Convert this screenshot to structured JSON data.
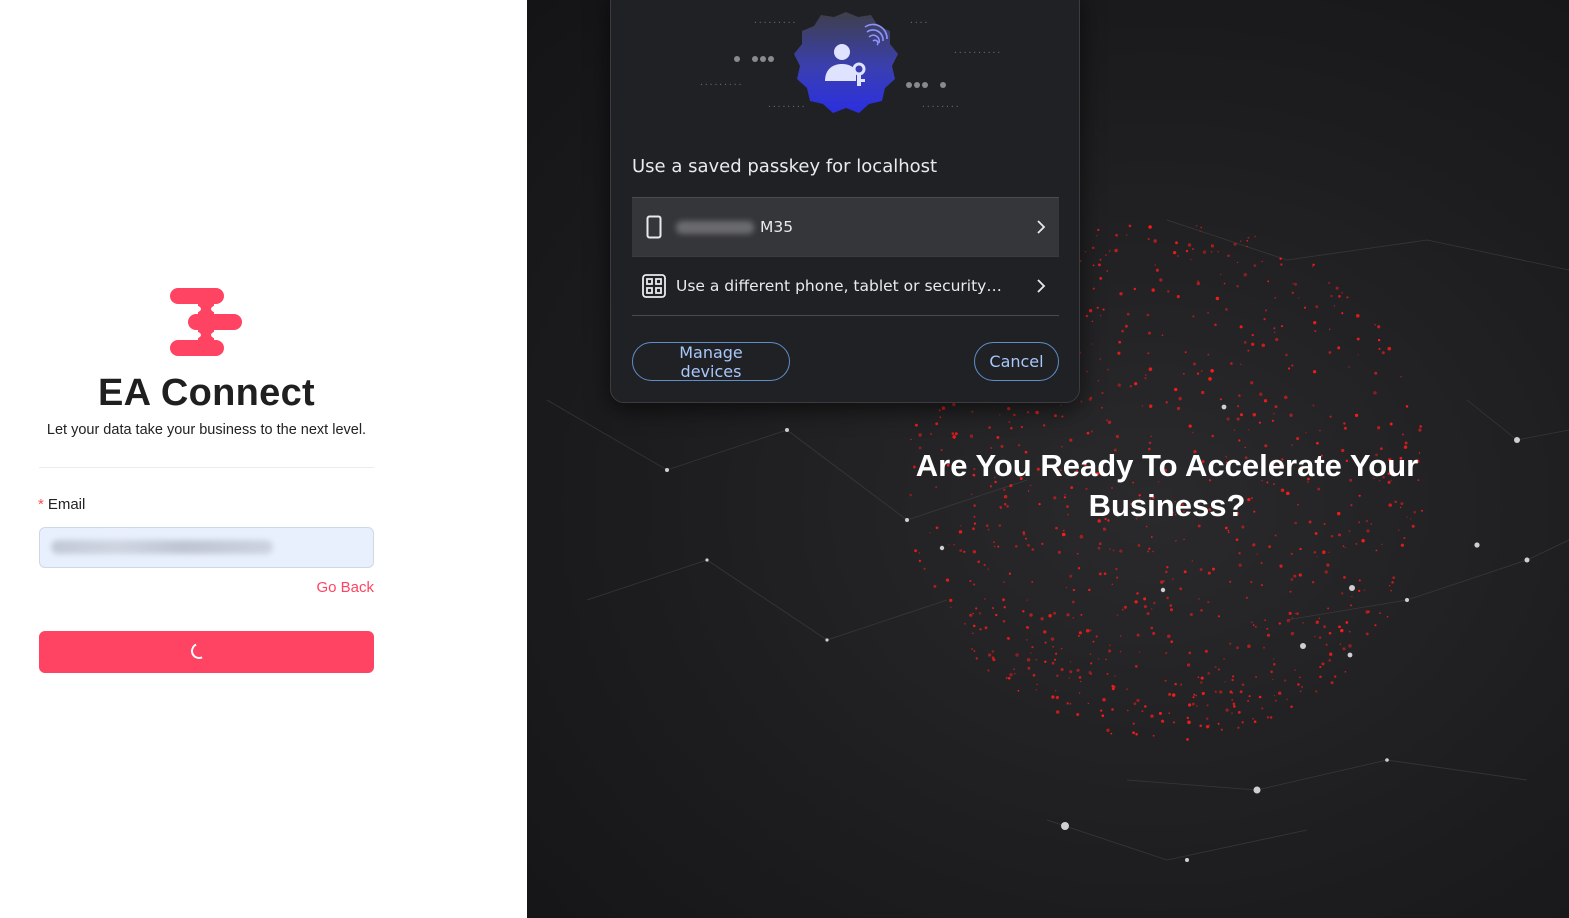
{
  "login": {
    "brand": "EA Connect",
    "tagline": "Let your data take your business to the next level.",
    "email_label": "Email",
    "required_mark": "*",
    "email_value": "",
    "go_back": "Go Back"
  },
  "hero": {
    "headline": "Are You Ready To Accelerate Your Business?"
  },
  "passkey_dialog": {
    "title": "Use a saved passkey for localhost",
    "options": [
      {
        "label": "M35",
        "icon": "phone-icon"
      },
      {
        "label": "Use a different phone, tablet or security…",
        "icon": "qr-code-icon"
      }
    ],
    "manage_button": "Manage devices",
    "cancel_button": "Cancel"
  },
  "colors": {
    "brand": "#ff4362",
    "dialog_bg": "#202124",
    "dialog_accent": "#a8c7fa",
    "hero_bg": "#1d1d1f",
    "particles": "#ff1a1a"
  }
}
